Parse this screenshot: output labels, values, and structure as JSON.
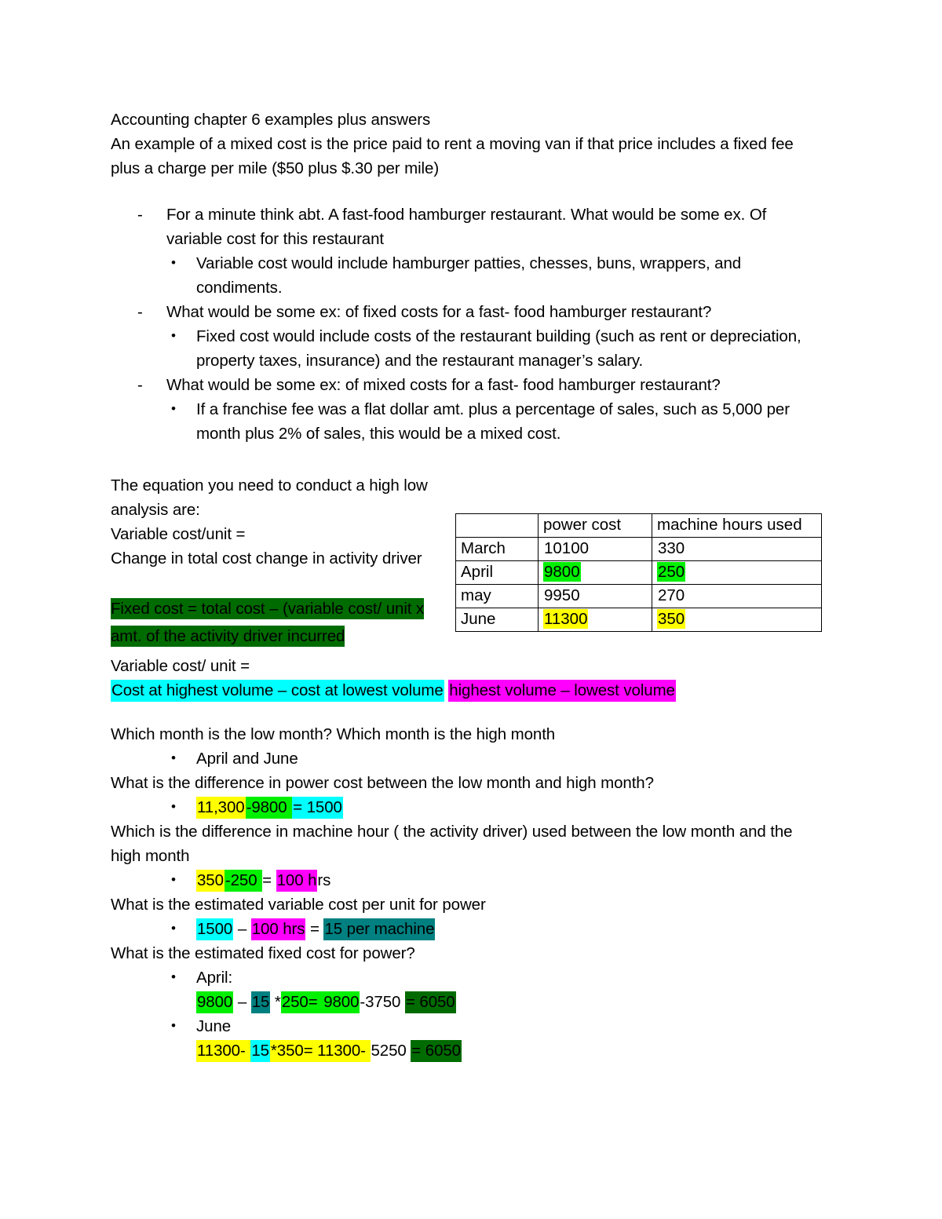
{
  "document": {
    "title": "Accounting chapter 6 examples plus answers",
    "intro": {
      "line1": "Accounting chapter 6 examples plus answers",
      "line2": "An example of a mixed cost is the price paid to rent a moving van if that price includes a fixed fee plus a charge per mile ($50 plus $.30 per mile)"
    },
    "markers": {
      "dash": "-",
      "bullet": "•"
    },
    "list": [
      {
        "marker": "dash",
        "text": "For a minute think abt. A fast-food hamburger restaurant. What would be some ex. Of variable cost for this restaurant"
      },
      {
        "marker": "bullet",
        "text": "Variable cost would include hamburger patties, chesses, buns, wrappers, and condiments."
      },
      {
        "marker": "dash",
        "text": "What would be some ex: of fixed costs for a fast- food hamburger restaurant?"
      },
      {
        "marker": "bullet",
        "text": "Fixed cost would include costs of the restaurant building (such as rent or depreciation, property taxes, insurance) and the restaurant manager’s salary."
      },
      {
        "marker": "dash",
        "text": "What would be some ex: of mixed costs for a fast- food hamburger restaurant?"
      },
      {
        "marker": "bullet",
        "text": "If a franchise fee was a flat dollar amt. plus a percentage of sales, such as 5,000 per month plus 2% of sales, this would be a mixed cost."
      }
    ],
    "equation": {
      "lead": "The equation you need to conduct a high low analysis are:",
      "variable_cost_label": "Variable cost/unit =",
      "numerator_denominator": "Change in total cost  change in activity driver",
      "fixed_cost_formula": "Fixed cost = total cost – (variable cost/ unit x amt. of the activity driver incurred"
    },
    "table": {
      "headers": [
        "",
        "power cost",
        "machine hours used"
      ],
      "rows": [
        {
          "month": "March",
          "power_cost": "10100",
          "machine_hours": "330",
          "power_hl": "none",
          "hours_hl": "none"
        },
        {
          "month": "April",
          "power_cost": "9800",
          "machine_hours": "250",
          "power_hl": "green",
          "hours_hl": "green"
        },
        {
          "month": "may",
          "power_cost": "9950",
          "machine_hours": "270",
          "power_hl": "none",
          "hours_hl": "none"
        },
        {
          "month": "June",
          "power_cost": "11300",
          "machine_hours": "350",
          "power_hl": "yellow",
          "hours_hl": "yellow"
        }
      ]
    },
    "varcost_formula": {
      "label": "Variable cost/ unit =",
      "numerator": "Cost at highest volume – cost at lowest volume",
      "denominator": "highest volume – lowest volume"
    },
    "qa": {
      "q1": "Which month is the low month? Which month is the high month",
      "a1": "April and June",
      "q2": "What is the difference in power cost between the low month and high month?",
      "a2": {
        "p1": "11,300",
        "p2": "-9800 ",
        "p3": "= 1500"
      },
      "q3": "Which is the difference in machine hour ( the activity driver) used between the low month and the high month",
      "a3": {
        "p1": "350",
        "p2": "-250 ",
        "p3": "= ",
        "p4": "100 h",
        "p5": "rs"
      },
      "q4": "What is the estimated variable cost per unit for power",
      "a4": {
        "p1": "1500",
        "p2": " – ",
        "p3": "100 hrs",
        "p4": " = ",
        "p5": "15 per machine"
      },
      "q5": "What is the estimated fixed cost for power?",
      "a5_label": "April:",
      "a5": {
        "p1": "9800",
        "p2": " – ",
        "p3": "15",
        "p4": " *",
        "p5": "250= ",
        "p6": "9800",
        "p7": "-3750 ",
        "p8": "= 6050"
      },
      "a6_label": "June",
      "a6": {
        "p1": "11300- ",
        "p2": "15",
        "p3": "*350= 11300- ",
        "p4": "5250 ",
        "p5": "= 6050"
      }
    },
    "colors": {
      "green": "#00b000",
      "bright_green": "#00f000",
      "yellow": "#ffff00",
      "cyan": "#00ffff",
      "magenta": "#ff00ff",
      "teal": "#008080",
      "dark_green": "#006b00"
    }
  }
}
